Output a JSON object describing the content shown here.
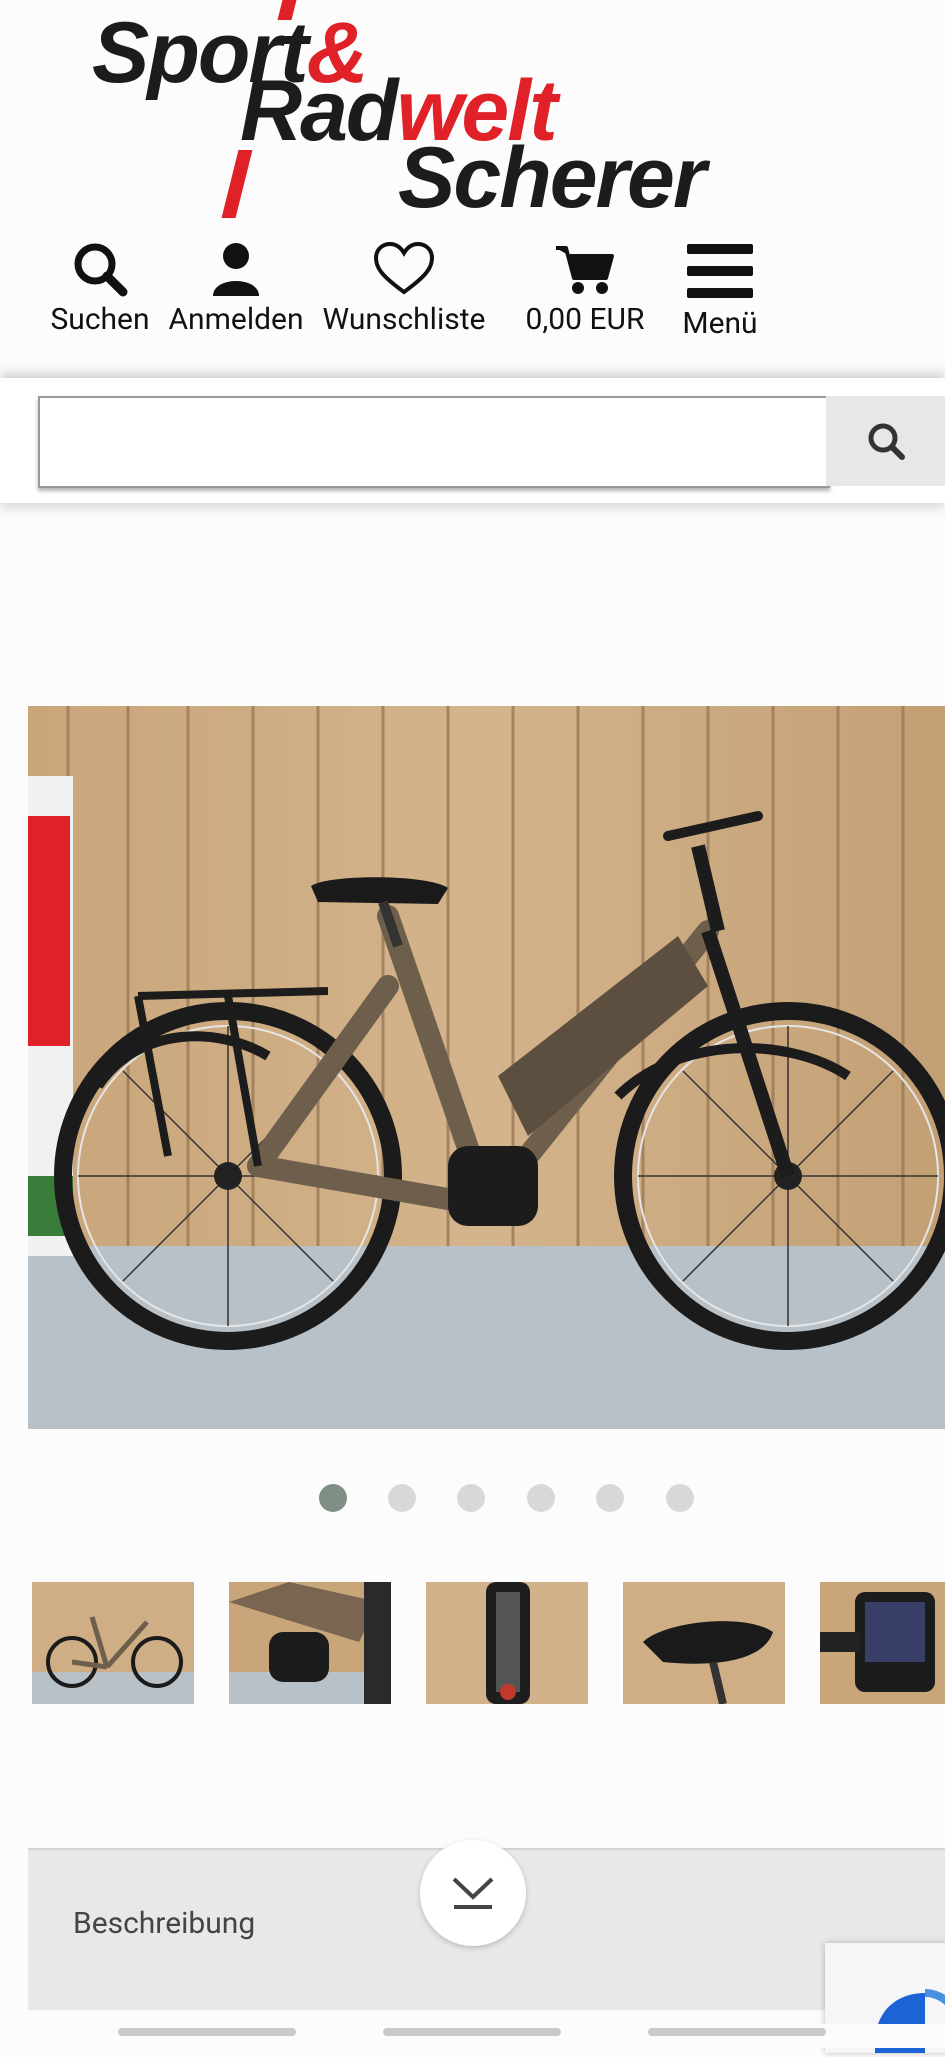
{
  "logo": {
    "line1a": "Sport",
    "line1b": "&",
    "line2a": "Rad",
    "line2b": "welt",
    "line3": "Scherer"
  },
  "nav": [
    {
      "label": "Suchen",
      "icon": "search-icon"
    },
    {
      "label": "Anmelden",
      "icon": "user-icon"
    },
    {
      "label": "Wunschliste",
      "icon": "heart-icon"
    },
    {
      "label": "0,00 EUR",
      "icon": "cart-icon"
    },
    {
      "label": "Menü",
      "icon": "hamburger-menu-icon"
    }
  ],
  "search": {
    "placeholder": "",
    "button_icon": "search-icon"
  },
  "gallery": {
    "total_slides": 6,
    "active_slide": 1,
    "thumbnail_count": 5
  },
  "description": {
    "label": "Beschreibung",
    "expand_icon": "chevron-down-icon"
  },
  "colors": {
    "brand_red": "#e02228",
    "dot_active": "#7f8f86",
    "dot_inactive": "#d8d8d8"
  }
}
